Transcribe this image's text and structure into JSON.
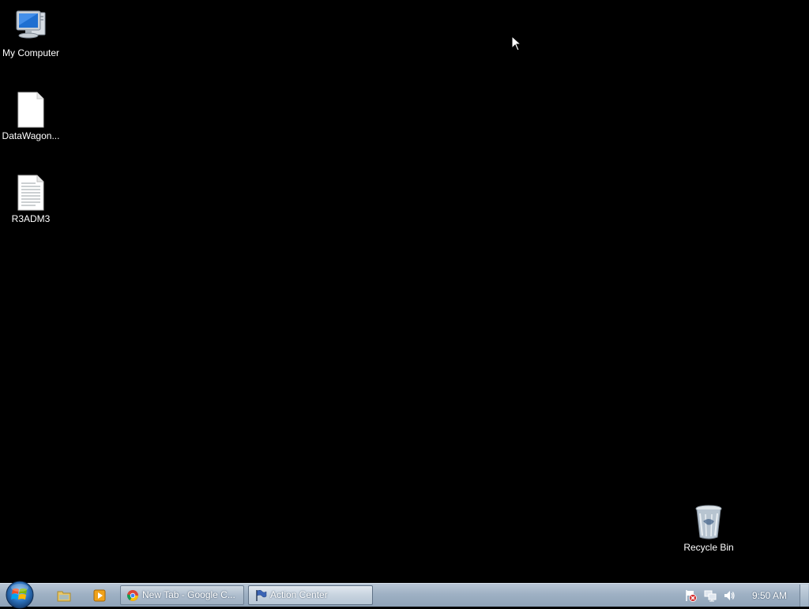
{
  "desktop": {
    "background_color": "#000000",
    "icons": [
      {
        "label": "My Computer",
        "icon": "computer-icon"
      },
      {
        "label": "DataWagon...",
        "icon": "blank-document-icon"
      },
      {
        "label": "R3ADM3",
        "icon": "text-document-icon"
      },
      {
        "label": "Recycle Bin",
        "icon": "recycle-bin-icon"
      }
    ]
  },
  "taskbar": {
    "start_icon": "windows-start-orb",
    "pinned": [
      {
        "name": "Windows Explorer",
        "icon": "folder-icon"
      },
      {
        "name": "Media Player",
        "icon": "media-player-icon"
      }
    ],
    "tasks": [
      {
        "label": "New Tab - Google C...",
        "icon": "chrome-icon",
        "active": false
      },
      {
        "label": "Action Center",
        "icon": "flag-icon",
        "active": true
      }
    ],
    "tray": {
      "icons": [
        "action-center-warning-icon",
        "network-icon",
        "volume-icon"
      ],
      "clock": "9:50 AM"
    }
  }
}
